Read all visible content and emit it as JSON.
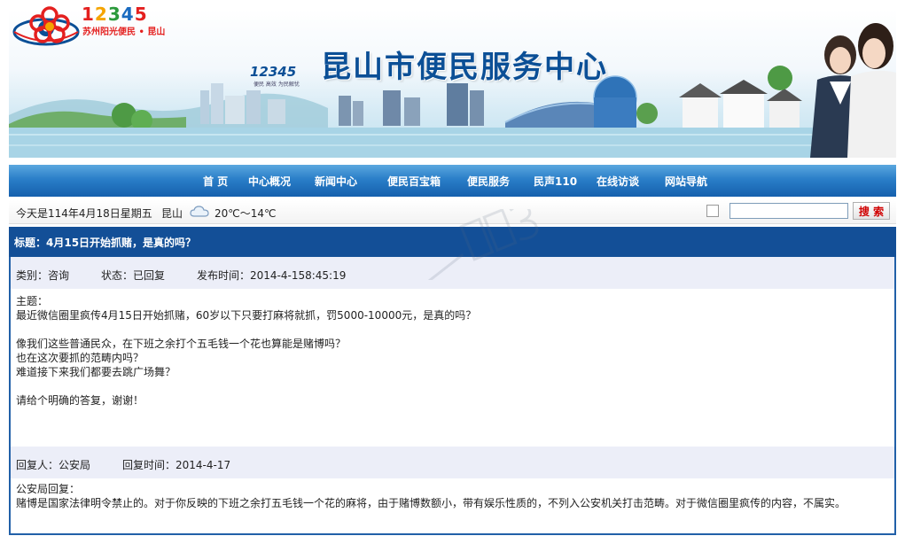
{
  "header": {
    "logo_number": [
      "1",
      "2",
      "3",
      "4",
      "5"
    ],
    "logo_subtitle": "苏州阳光便民 • 昆山",
    "banner_title": "昆山市便民服务中心",
    "emblem_number": "12345",
    "emblem_subtitle": "便民 高效 为民解忧"
  },
  "nav": {
    "items": [
      "首 页",
      "中心概况",
      "新闻中心",
      "便民百宝箱",
      "便民服务",
      "民声110",
      "在线访谈",
      "网站导航"
    ]
  },
  "infobar": {
    "date": "今天是114年4月18日星期五",
    "city": "昆山",
    "weather_icon": "cloud-icon",
    "temperature": "20℃～14℃",
    "search_placeholder": "",
    "search_button": "搜 索"
  },
  "post": {
    "title": "标题：4月15日开始抓赌，是真的吗？",
    "category": "类别：咨询",
    "status": "状态：已回复",
    "publish_time": "发布时间：2014-4-158:45:19",
    "body_lines": [
      "主题：",
      "最近微信圈里疯传4月15日开始抓赌，60岁以下只要打麻将就抓，罚5000-10000元，是真的吗？",
      "",
      "像我们这些普通民众，在下班之余打个五毛钱一个花也算能是赌博吗？",
      "也在这次要抓的范畴内吗？",
      "难道接下来我们都要去跳广场舞？",
      "",
      "请给个明确的答复，谢谢！"
    ]
  },
  "reply": {
    "replier": "回复人：公安局",
    "reply_time": "回复时间：2014-4-17",
    "lines": [
      "公安局回复：",
      "赌博是国家法律明令禁止的。对于你反映的下班之余打五毛钱一个花的麻将，由于赌博数额小，带有娱乐性质的，不列入公安机关打击范畴。对于微信圈里疯传的内容，不属实。"
    ]
  },
  "colors": {
    "nav_blue": "#1f6fba",
    "title_bar": "#134f97",
    "meta_bg": "#eceef8",
    "search_red": "#d00000"
  }
}
